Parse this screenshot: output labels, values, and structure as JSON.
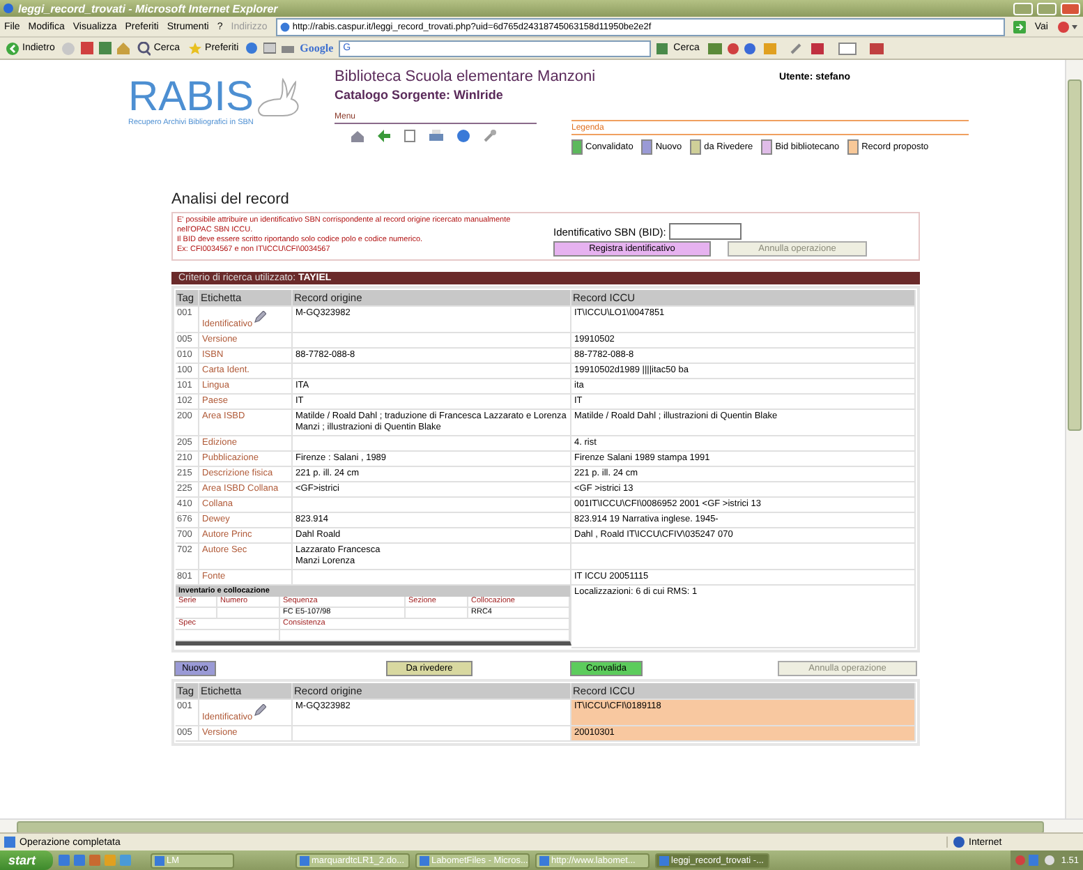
{
  "browser": {
    "title": "leggi_record_trovati - Microsoft Internet Explorer",
    "menu": [
      "File",
      "Modifica",
      "Visualizza",
      "Preferiti",
      "Strumenti",
      "?"
    ],
    "address_label": "Indirizzo",
    "url": "http://rabis.caspur.it/leggi_record_trovati.php?uid=6d765d24318745063158d11950be2e2f",
    "go": "Vai",
    "toolbar": [
      {
        "label": "Indietro"
      },
      {
        "label": "Cerca"
      },
      {
        "label": "Preferiti"
      }
    ],
    "google": "Google",
    "google_field": "G",
    "google_search": "Cerca"
  },
  "header": {
    "logo": "RABIS",
    "tagline": "Recupero Archivi Bibliografici in SBN",
    "library": "Biblioteca Scuola elementare Manzoni",
    "catalog": "Catalogo Sorgente: WinIride",
    "user": "Utente: stefano",
    "menu_title": "Menu",
    "legend_title": "Legenda",
    "legend": [
      {
        "label": "Convalidato",
        "color": "#5cb85c"
      },
      {
        "label": "Nuovo",
        "color": "#9a9ad6"
      },
      {
        "label": "da Rivedere",
        "color": "#cfcf98"
      },
      {
        "label": "Bid bibliotecano",
        "color": "#e0bce8"
      },
      {
        "label": "Record proposto",
        "color": "#f8c898"
      }
    ]
  },
  "analysis": {
    "title": "Analisi del record",
    "notice": [
      "E' possibile attribuire un identificativo SBN corrispondente al record origine ricercato manualmente nell'OPAC SBN ICCU.",
      "Il BID deve essere scritto riportando solo codice polo e codice numerico.",
      "Ex: CFI0034567 e non IT\\ICCU\\CFI\\0034567"
    ],
    "bid_label": "Identificativo SBN (BID):",
    "bid_buttons": [
      {
        "label": "Registra identificativo",
        "disabled": false
      },
      {
        "label": "Annulla operazione",
        "disabled": true
      }
    ],
    "criterion": "Criterio di ricerca utilizzato: **TAYIEL**",
    "columns": [
      "Tag",
      "Etichetta",
      "Record origine",
      "Record ICCU"
    ],
    "rows": [
      {
        "tag": "001",
        "label": "Identificativo",
        "edit": true,
        "origin": "M-GQ323982",
        "iccu": "IT\\ICCU\\LO1\\0047851"
      },
      {
        "tag": "005",
        "label": "Versione",
        "iccu": "19910502"
      },
      {
        "tag": "010",
        "label": "ISBN",
        "origin": "88-7782-088-8",
        "iccu": "88-7782-088-8"
      },
      {
        "tag": "100",
        "label": "Carta Ident.",
        "iccu": "19910502d1989 ||||itac50 ba"
      },
      {
        "tag": "101",
        "label": "Lingua",
        "origin": "ITA",
        "iccu": "ita"
      },
      {
        "tag": "102",
        "label": "Paese",
        "origin": "IT",
        "iccu": "IT"
      },
      {
        "tag": "200",
        "label": "Area ISBD",
        "origin": "Matilde / Roald Dahl ; traduzione di Francesca Lazzarato e Lorenza Manzi ; illustrazioni di Quentin Blake",
        "iccu": "Matilde / Roald Dahl ; illustrazioni di Quentin Blake"
      },
      {
        "tag": "205",
        "label": "Edizione",
        "iccu": "4. rist"
      },
      {
        "tag": "210",
        "label": "Pubblicazione",
        "origin": "Firenze : Salani , 1989",
        "iccu": "Firenze Salani 1989 stampa 1991"
      },
      {
        "tag": "215",
        "label": "Descrizione fisica",
        "origin": "221 p. ill. 24 cm",
        "iccu": "221 p. ill. 24 cm"
      },
      {
        "tag": "225",
        "label": "Area ISBD Collana",
        "origin": "<GF>istrici",
        "iccu": "<GF >istrici 13"
      },
      {
        "tag": "410",
        "label": "Collana",
        "iccu": "001IT\\ICCU\\CFI\\0086952 2001 <GF >istrici 13"
      },
      {
        "tag": "676",
        "label": "Dewey",
        "origin": "823.914",
        "iccu": "823.914 19 Narrativa inglese. 1945-"
      },
      {
        "tag": "700",
        "label": "Autore Princ",
        "origin": "Dahl Roald",
        "iccu": "Dahl , Roald IT\\ICCU\\CFIV\\035247 070"
      },
      {
        "tag": "702",
        "label": "Autore Sec",
        "origin": "Lazzarato Francesca\nManzi Lorenza"
      },
      {
        "tag": "801",
        "label": "Fonte",
        "iccu": "IT ICCU 20051115"
      }
    ],
    "inventory": {
      "title": "Inventario e collocazione",
      "fields": [
        {
          "label": "Serie"
        },
        {
          "label": "Numero"
        },
        {
          "label": "Sequenza",
          "value": "FC E5-107/98"
        },
        {
          "label": "Sezione"
        },
        {
          "label": "Collocazione",
          "value": "RRC4"
        }
      ],
      "fields2": [
        {
          "label": "Spec"
        },
        {
          "label": "Consistenza"
        }
      ],
      "locations": "Localizzazioni: 6 di cui RMS: 1"
    },
    "actions": [
      {
        "label": "Nuovo",
        "kind": "nuovo",
        "disabled": false
      },
      {
        "label": "Da rivedere",
        "kind": "rivedere",
        "disabled": false
      },
      {
        "label": "Convalida",
        "kind": "convalida",
        "disabled": false
      },
      {
        "label": "Annulla operazione",
        "kind": "annulla",
        "disabled": true
      }
    ],
    "columns2": [
      "Tag",
      "Etichetta",
      "Record origine",
      "Record ICCU"
    ],
    "rows2": [
      {
        "tag": "001",
        "label": "Identificativo",
        "edit": true,
        "origin": "M-GQ323982",
        "iccu": "IT\\ICCU\\CFI\\0189118",
        "proposed": true
      },
      {
        "tag": "005",
        "label": "Versione",
        "iccu": "20010301",
        "proposed": true
      }
    ]
  },
  "status_bar": {
    "text": "Operazione completata",
    "zone": "Internet"
  },
  "taskbar": {
    "start": "start",
    "items": [
      {
        "label": "LM",
        "selected": false
      },
      {
        "label": "marquardtcLR1_2.do...",
        "selected": false
      },
      {
        "label": "LabometFiles - Micros...",
        "selected": false
      },
      {
        "label": "http://www.labomet...",
        "selected": false
      },
      {
        "label": "leggi_record_trovati -...",
        "selected": true
      }
    ],
    "clock": "1.51"
  }
}
